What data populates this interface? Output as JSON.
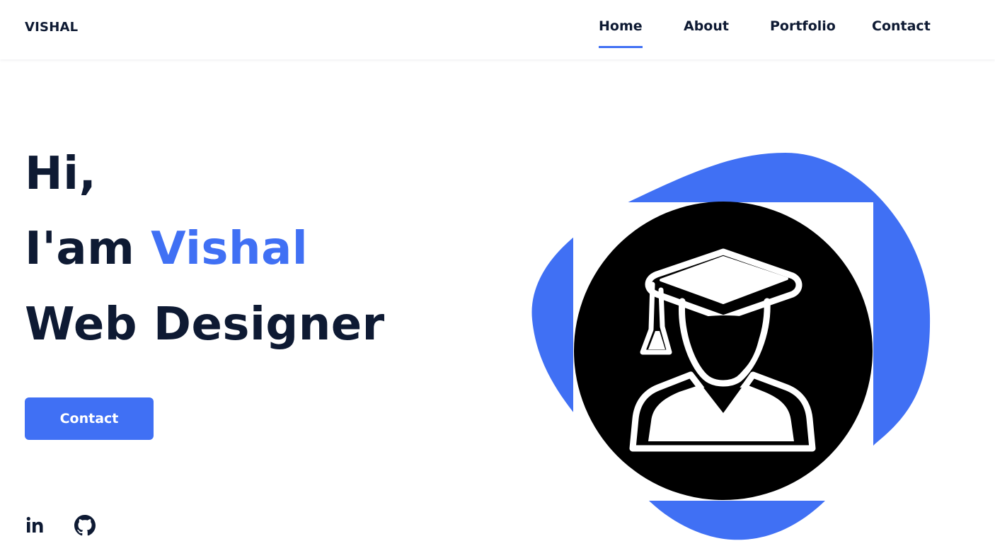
{
  "header": {
    "logo": "VISHAL",
    "nav": [
      {
        "label": "Home",
        "active": true
      },
      {
        "label": "About",
        "active": false
      },
      {
        "label": "Portfolio",
        "active": false
      },
      {
        "label": "Contact",
        "active": false
      }
    ]
  },
  "hero": {
    "greeting": "Hi,",
    "intro_prefix": "I'am",
    "name": "Vishal",
    "role": "Web Designer",
    "cta_label": "Contact"
  },
  "social": [
    {
      "icon": "linkedin-icon"
    },
    {
      "icon": "github-icon"
    }
  ],
  "illustration": {
    "icon": "graduate-student-icon"
  },
  "colors": {
    "accent": "#4070f4",
    "text": "#0e1a33",
    "background": "#ffffff"
  }
}
